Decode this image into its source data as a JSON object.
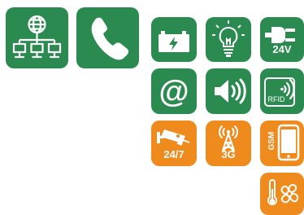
{
  "tiles": [
    {
      "icon": "network-icon",
      "color": "#2b8a4f"
    },
    {
      "icon": "phone-icon",
      "color": "#2b8a4f"
    },
    {
      "icon": "battery-icon",
      "color": "#2b8a4f"
    },
    {
      "icon": "light-bulb-icon",
      "color": "#2b8a4f"
    },
    {
      "icon": "power-plug-icon",
      "color": "#2b8a4f",
      "label": "24V"
    },
    {
      "icon": "email-at-icon",
      "color": "#2b8a4f"
    },
    {
      "icon": "speaker-icon",
      "color": "#2b8a4f"
    },
    {
      "icon": "rfid-card-icon",
      "color": "#2b8a4f",
      "label": "RFID"
    },
    {
      "icon": "cctv-camera-icon",
      "color": "#ef8a1d",
      "label": "24/7"
    },
    {
      "icon": "antenna-tower-icon",
      "color": "#ef8a1d",
      "label": "3G"
    },
    {
      "icon": "gsm-phone-icon",
      "color": "#ef8a1d",
      "label": "GSM"
    },
    {
      "icon": "climate-control-icon",
      "color": "#ef8a1d"
    }
  ],
  "labels": {
    "power": "24V",
    "rfid": "RFID",
    "cctv": "24/7",
    "tower": "3G",
    "gsm": "GSM"
  }
}
